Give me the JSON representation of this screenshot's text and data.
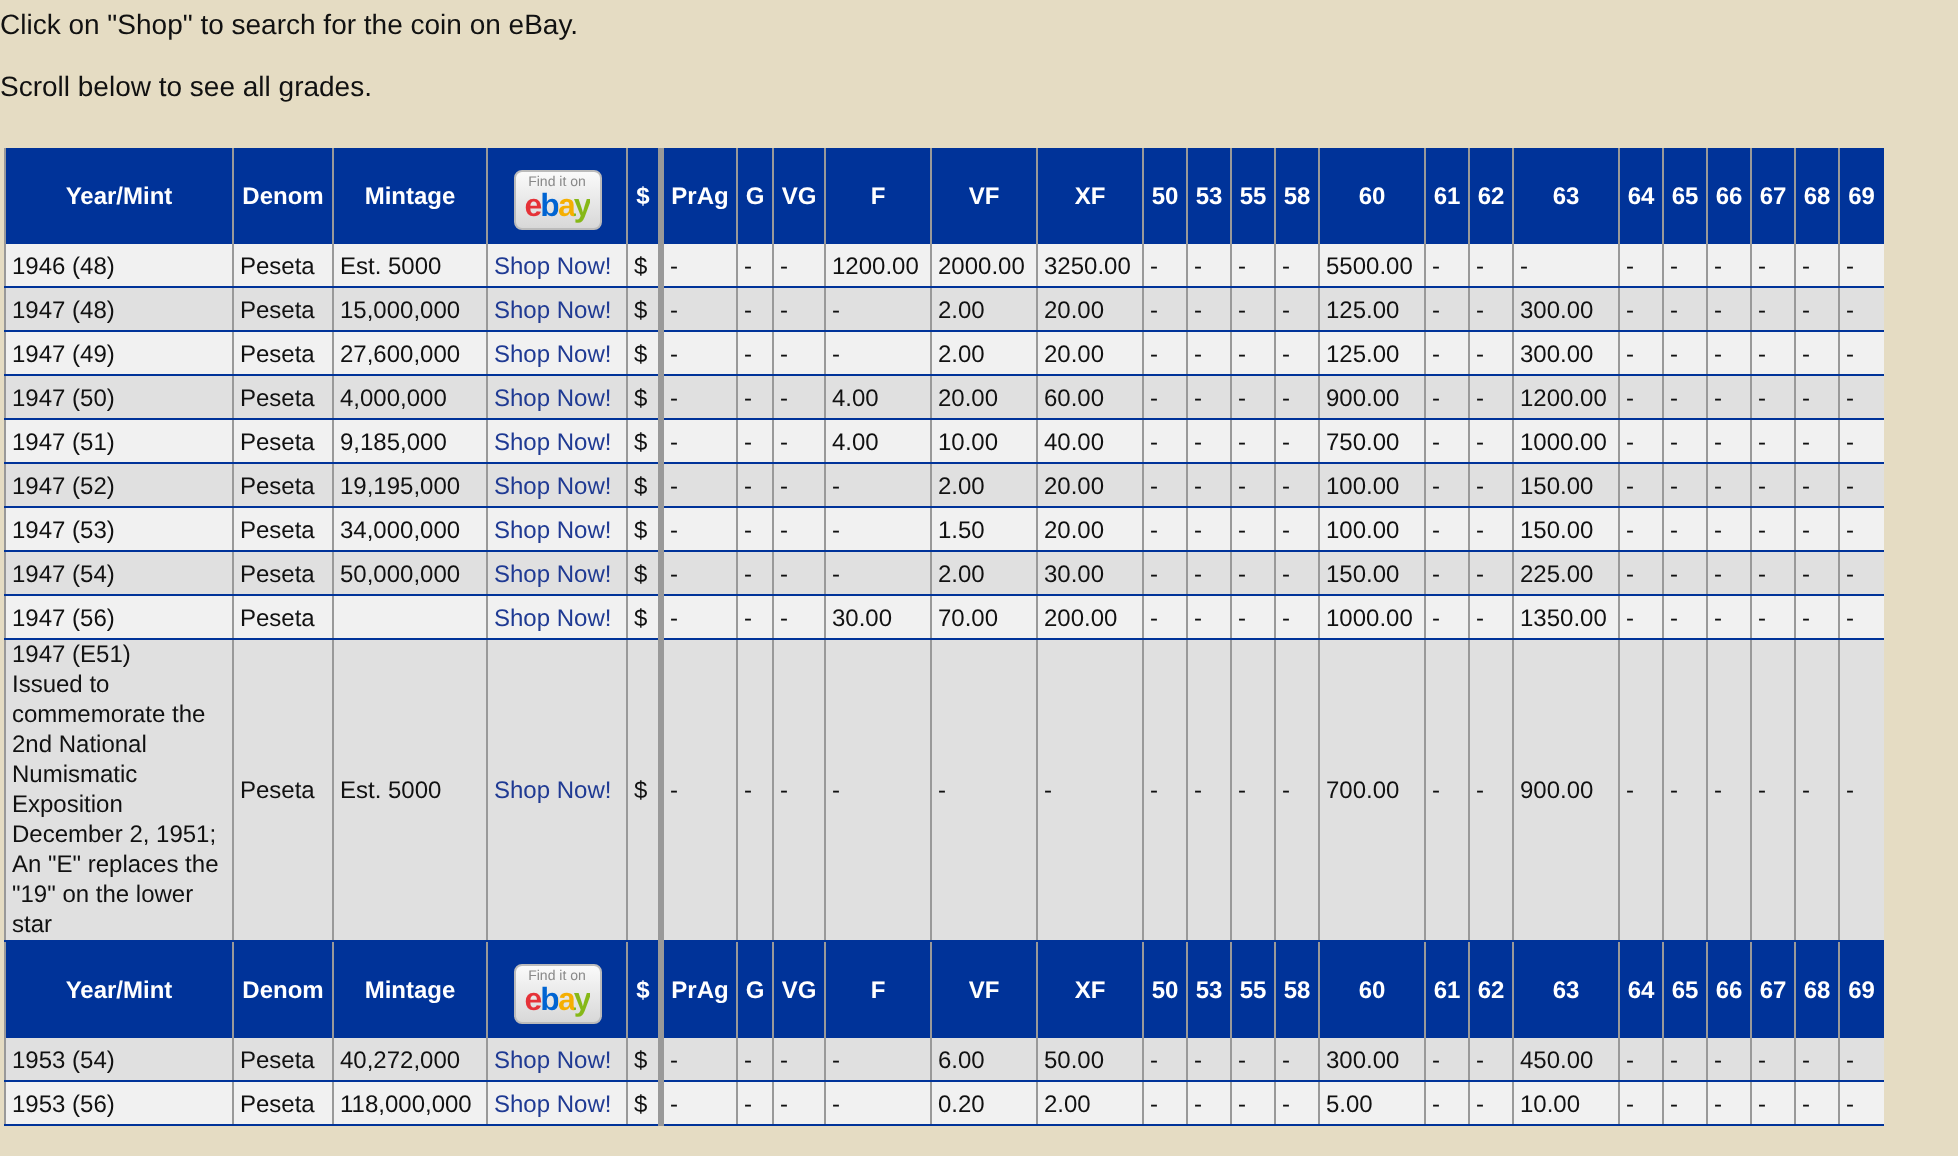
{
  "intro": [
    "Click on \"Shop\" to search for the coin on eBay.",
    "Scroll below to see all grades."
  ],
  "table": {
    "rows": [
      {
        "kind": "header",
        "year_mint": "Year/Mint",
        "denom": "Denom",
        "mintage": "Mintage",
        "shop": {
          "caption": "Find it on",
          "brand": "ebay"
        },
        "currency": "$",
        "grades": [
          "PrAg",
          "G",
          "VG",
          "F",
          "VF",
          "XF",
          "50",
          "53",
          "55",
          "58",
          "60",
          "61",
          "62",
          "63",
          "64",
          "65",
          "66",
          "67",
          "68",
          "69"
        ]
      },
      {
        "kind": "coin",
        "year_mint": "1946 (48)",
        "denom": "Peseta",
        "mintage": "Est. 5000",
        "shop": "Shop Now!",
        "currency": "$",
        "grades": [
          "-",
          "-",
          "-",
          "1200.00",
          "2000.00",
          "3250.00",
          "-",
          "-",
          "-",
          "-",
          "5500.00",
          "-",
          "-",
          "-",
          "-",
          "-",
          "-",
          "-",
          "-",
          "-"
        ]
      },
      {
        "kind": "coin",
        "year_mint": "1947 (48)",
        "denom": "Peseta",
        "mintage": "15,000,000",
        "shop": "Shop Now!",
        "currency": "$",
        "grades": [
          "-",
          "-",
          "-",
          "-",
          "2.00",
          "20.00",
          "-",
          "-",
          "-",
          "-",
          "125.00",
          "-",
          "-",
          "300.00",
          "-",
          "-",
          "-",
          "-",
          "-",
          "-"
        ]
      },
      {
        "kind": "coin",
        "year_mint": "1947 (49)",
        "denom": "Peseta",
        "mintage": "27,600,000",
        "shop": "Shop Now!",
        "currency": "$",
        "grades": [
          "-",
          "-",
          "-",
          "-",
          "2.00",
          "20.00",
          "-",
          "-",
          "-",
          "-",
          "125.00",
          "-",
          "-",
          "300.00",
          "-",
          "-",
          "-",
          "-",
          "-",
          "-"
        ]
      },
      {
        "kind": "coin",
        "year_mint": "1947 (50)",
        "denom": "Peseta",
        "mintage": "4,000,000",
        "shop": "Shop Now!",
        "currency": "$",
        "grades": [
          "-",
          "-",
          "-",
          "4.00",
          "20.00",
          "60.00",
          "-",
          "-",
          "-",
          "-",
          "900.00",
          "-",
          "-",
          "1200.00",
          "-",
          "-",
          "-",
          "-",
          "-",
          "-"
        ]
      },
      {
        "kind": "coin",
        "year_mint": "1947 (51)",
        "denom": "Peseta",
        "mintage": "9,185,000",
        "shop": "Shop Now!",
        "currency": "$",
        "grades": [
          "-",
          "-",
          "-",
          "4.00",
          "10.00",
          "40.00",
          "-",
          "-",
          "-",
          "-",
          "750.00",
          "-",
          "-",
          "1000.00",
          "-",
          "-",
          "-",
          "-",
          "-",
          "-"
        ]
      },
      {
        "kind": "coin",
        "year_mint": "1947 (52)",
        "denom": "Peseta",
        "mintage": "19,195,000",
        "shop": "Shop Now!",
        "currency": "$",
        "grades": [
          "-",
          "-",
          "-",
          "-",
          "2.00",
          "20.00",
          "-",
          "-",
          "-",
          "-",
          "100.00",
          "-",
          "-",
          "150.00",
          "-",
          "-",
          "-",
          "-",
          "-",
          "-"
        ]
      },
      {
        "kind": "coin",
        "year_mint": "1947 (53)",
        "denom": "Peseta",
        "mintage": "34,000,000",
        "shop": "Shop Now!",
        "currency": "$",
        "grades": [
          "-",
          "-",
          "-",
          "-",
          "1.50",
          "20.00",
          "-",
          "-",
          "-",
          "-",
          "100.00",
          "-",
          "-",
          "150.00",
          "-",
          "-",
          "-",
          "-",
          "-",
          "-"
        ]
      },
      {
        "kind": "coin",
        "year_mint": "1947 (54)",
        "denom": "Peseta",
        "mintage": "50,000,000",
        "shop": "Shop Now!",
        "currency": "$",
        "grades": [
          "-",
          "-",
          "-",
          "-",
          "2.00",
          "30.00",
          "-",
          "-",
          "-",
          "-",
          "150.00",
          "-",
          "-",
          "225.00",
          "-",
          "-",
          "-",
          "-",
          "-",
          "-"
        ]
      },
      {
        "kind": "coin",
        "year_mint": "1947 (56)",
        "denom": "Peseta",
        "shop": "Shop Now!",
        "currency": "$",
        "grades": [
          "-",
          "-",
          "-",
          "30.00",
          "70.00",
          "200.00",
          "-",
          "-",
          "-",
          "-",
          "1000.00",
          "-",
          "-",
          "1350.00",
          "-",
          "-",
          "-",
          "-",
          "-",
          "-"
        ]
      },
      {
        "kind": "coin",
        "year_mint": "1947 (E51)",
        "note": "Issued to commemorate the 2nd National Numismatic Exposition December 2, 1951; An \"E\" replaces the \"19\" on the lower star",
        "denom": "Peseta",
        "mintage": "Est. 5000",
        "shop": "Shop Now!",
        "currency": "$",
        "grades": [
          "-",
          "-",
          "-",
          "-",
          "-",
          "-",
          "-",
          "-",
          "-",
          "-",
          "700.00",
          "-",
          "-",
          "900.00",
          "-",
          "-",
          "-",
          "-",
          "-",
          "-"
        ]
      },
      {
        "kind": "header",
        "year_mint": "Year/Mint",
        "denom": "Denom",
        "mintage": "Mintage",
        "shop": {
          "caption": "Find it on",
          "brand": "ebay"
        },
        "currency": "$",
        "grades": [
          "PrAg",
          "G",
          "VG",
          "F",
          "VF",
          "XF",
          "50",
          "53",
          "55",
          "58",
          "60",
          "61",
          "62",
          "63",
          "64",
          "65",
          "66",
          "67",
          "68",
          "69"
        ]
      },
      {
        "kind": "coin",
        "year_mint": "1953 (54)",
        "denom": "Peseta",
        "mintage": "40,272,000",
        "shop": "Shop Now!",
        "currency": "$",
        "grades": [
          "-",
          "-",
          "-",
          "-",
          "6.00",
          "50.00",
          "-",
          "-",
          "-",
          "-",
          "300.00",
          "-",
          "-",
          "450.00",
          "-",
          "-",
          "-",
          "-",
          "-",
          "-"
        ]
      },
      {
        "kind": "coin",
        "year_mint": "1953 (56)",
        "denom": "Peseta",
        "mintage": "118,000,000",
        "shop": "Shop Now!",
        "currency": "$",
        "grades": [
          "-",
          "-",
          "-",
          "-",
          "0.20",
          "2.00",
          "-",
          "-",
          "-",
          "-",
          "5.00",
          "-",
          "-",
          "10.00",
          "-",
          "-",
          "-",
          "-",
          "-",
          "-"
        ]
      }
    ]
  }
}
